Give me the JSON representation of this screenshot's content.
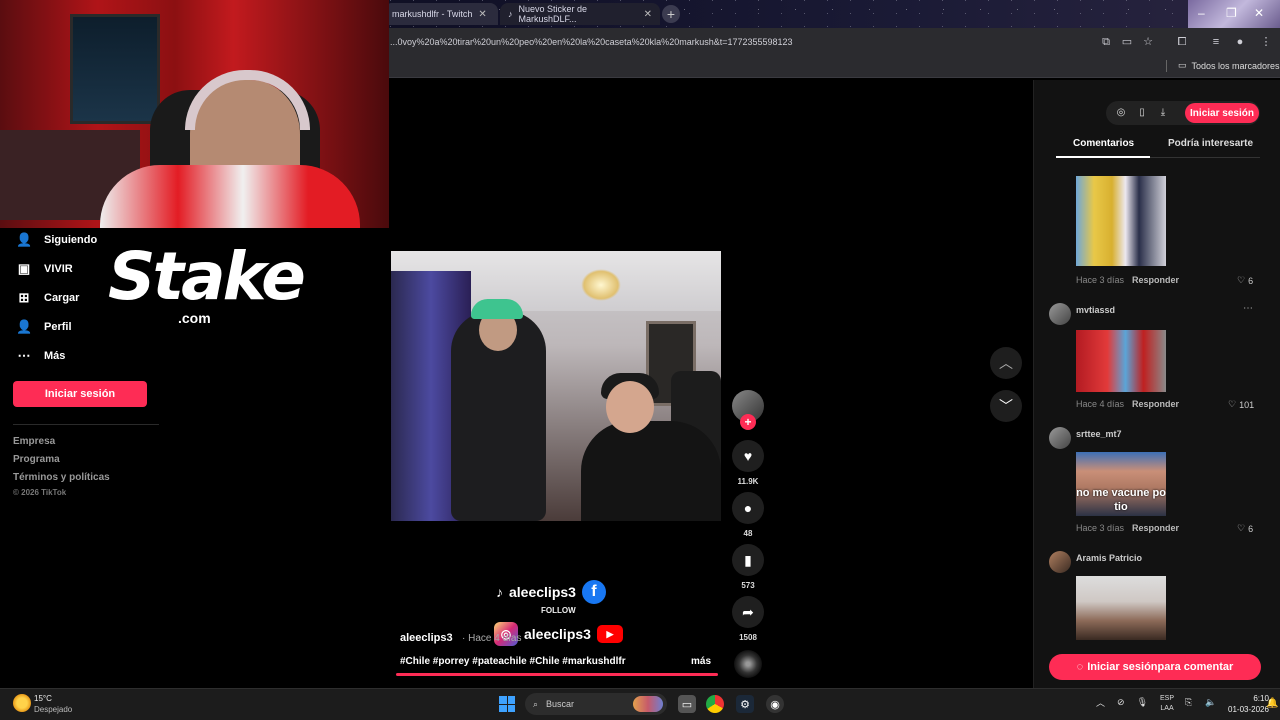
{
  "browser": {
    "tabs": [
      {
        "label": "markushdlfr - Twitch"
      },
      {
        "label": "Nuevo Sticker de MarkushDLF..."
      }
    ],
    "new_tab": "+",
    "url": "...0voy%20a%20tirar%20un%20peo%20en%20la%20caseta%20kla%20markush&t=1772355598123",
    "bookmarks_label": "Todos los marcadores"
  },
  "nav": {
    "items": [
      {
        "label": "Siguiendo",
        "icon": "following-icon"
      },
      {
        "label": "VIVIR",
        "icon": "live-icon"
      },
      {
        "label": "Cargar",
        "icon": "upload-icon"
      },
      {
        "label": "Perfil",
        "icon": "profile-icon"
      },
      {
        "label": "Más",
        "icon": "more-icon"
      }
    ],
    "login": "Iniciar sesión",
    "footer": [
      "Empresa",
      "Programa",
      "Términos y políticas"
    ],
    "copyright": "© 2026 TikTok"
  },
  "overlay": {
    "stake_word": "Stake",
    "stake_com": ".com"
  },
  "video": {
    "socials_top": "aleeclips3",
    "follow": "FOLLOW",
    "socials_bottom": "aleeclips3",
    "author": "aleeclips3",
    "time": "· Hace 4 días",
    "hashtags": "#Chile #porrey #pateachile #Chile #markushdlfr",
    "more": "más"
  },
  "actions": {
    "likes": "11.9K",
    "comments": "48",
    "saves": "573",
    "shares": "1508"
  },
  "right_panel": {
    "login": "Iniciar sesión",
    "tabs": [
      "Comentarios",
      "Podría interesarte"
    ],
    "comments": [
      {
        "user": "",
        "time": "Hace 3 días",
        "reply": "Responder",
        "likes": "6"
      },
      {
        "user": "mvtiassd",
        "time": "Hace 4 días",
        "reply": "Responder",
        "likes": "101"
      },
      {
        "user": "srttee_mt7",
        "time": "Hace 3 días",
        "reply": "Responder",
        "likes": "6",
        "image_text": "no me vacune po tio"
      },
      {
        "user": "Aramis Patricio"
      }
    ],
    "comment_login": "Iniciar sesiónpara comentar"
  },
  "taskbar": {
    "temp": "15°C",
    "weather": "Despejado",
    "search": "Buscar",
    "lang_top": "ESP",
    "lang_bottom": "LAA",
    "time": "6:10",
    "date": "01-03-2026"
  },
  "colors": {
    "accent": "#fe2c55",
    "panel": "#121212"
  }
}
